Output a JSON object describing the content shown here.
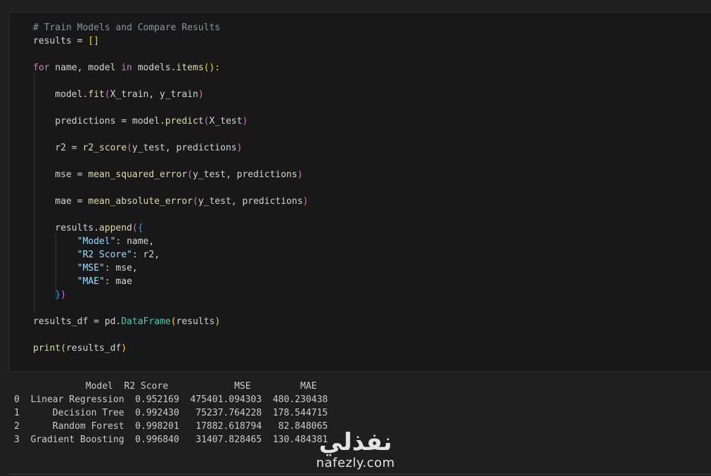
{
  "cell": {
    "code_lines": [
      [
        {
          "t": "# Train Models and Compare Results",
          "c": "comment"
        }
      ],
      [
        {
          "t": "results",
          "c": "plain"
        },
        {
          "t": " = ",
          "c": "plain"
        },
        {
          "t": "[]",
          "c": "b1"
        }
      ],
      [],
      [
        {
          "t": "for",
          "c": "kw"
        },
        {
          "t": " name, model ",
          "c": "plain"
        },
        {
          "t": "in",
          "c": "kw"
        },
        {
          "t": " models.",
          "c": "plain"
        },
        {
          "t": "items",
          "c": "fn"
        },
        {
          "t": "():",
          "c": "b1"
        }
      ],
      [],
      [
        {
          "t": "    model.",
          "c": "plain"
        },
        {
          "t": "fit",
          "c": "fn"
        },
        {
          "t": "(",
          "c": "b2"
        },
        {
          "t": "X_train, y_train",
          "c": "plain"
        },
        {
          "t": ")",
          "c": "b2"
        }
      ],
      [],
      [
        {
          "t": "    predictions = model.",
          "c": "plain"
        },
        {
          "t": "predict",
          "c": "fn"
        },
        {
          "t": "(",
          "c": "b2"
        },
        {
          "t": "X_test",
          "c": "plain"
        },
        {
          "t": ")",
          "c": "b2"
        }
      ],
      [],
      [
        {
          "t": "    r2 = ",
          "c": "plain"
        },
        {
          "t": "r2_score",
          "c": "fn"
        },
        {
          "t": "(",
          "c": "b2"
        },
        {
          "t": "y_test, predictions",
          "c": "plain"
        },
        {
          "t": ")",
          "c": "b2"
        }
      ],
      [],
      [
        {
          "t": "    mse = ",
          "c": "plain"
        },
        {
          "t": "mean_squared_error",
          "c": "fn"
        },
        {
          "t": "(",
          "c": "b2"
        },
        {
          "t": "y_test, predictions",
          "c": "plain"
        },
        {
          "t": ")",
          "c": "b2"
        }
      ],
      [],
      [
        {
          "t": "    mae = ",
          "c": "plain"
        },
        {
          "t": "mean_absolute_error",
          "c": "fn"
        },
        {
          "t": "(",
          "c": "b2"
        },
        {
          "t": "y_test, predictions",
          "c": "plain"
        },
        {
          "t": ")",
          "c": "b2"
        }
      ],
      [],
      [
        {
          "t": "    results.",
          "c": "plain"
        },
        {
          "t": "append",
          "c": "fn"
        },
        {
          "t": "(",
          "c": "b2"
        },
        {
          "t": "{",
          "c": "b3"
        }
      ],
      [
        {
          "t": "        ",
          "c": "plain"
        },
        {
          "t": "\"Model\"",
          "c": "var"
        },
        {
          "t": ": name,",
          "c": "plain"
        }
      ],
      [
        {
          "t": "        ",
          "c": "plain"
        },
        {
          "t": "\"R2 Score\"",
          "c": "var"
        },
        {
          "t": ": r2,",
          "c": "plain"
        }
      ],
      [
        {
          "t": "        ",
          "c": "plain"
        },
        {
          "t": "\"MSE\"",
          "c": "var"
        },
        {
          "t": ": mse,",
          "c": "plain"
        }
      ],
      [
        {
          "t": "        ",
          "c": "plain"
        },
        {
          "t": "\"MAE\"",
          "c": "var"
        },
        {
          "t": ": mae",
          "c": "plain"
        }
      ],
      [
        {
          "t": "    ",
          "c": "plain"
        },
        {
          "t": "}",
          "c": "b3"
        },
        {
          "t": ")",
          "c": "b2"
        }
      ],
      [],
      [
        {
          "t": "results_df = pd.",
          "c": "plain"
        },
        {
          "t": "DataFrame",
          "c": "fnblue"
        },
        {
          "t": "(",
          "c": "b1"
        },
        {
          "t": "results",
          "c": "plain"
        },
        {
          "t": ")",
          "c": "b1"
        }
      ],
      [],
      [
        {
          "t": "print",
          "c": "fn"
        },
        {
          "t": "(",
          "c": "b1"
        },
        {
          "t": "results_df",
          "c": "plain"
        },
        {
          "t": ")",
          "c": "b1"
        }
      ]
    ]
  },
  "output": {
    "header": "             Model  R2 Score            MSE         MAE",
    "rows": [
      "0  Linear Regression  0.952169  475401.094303  480.230438",
      "1      Decision Tree  0.992430   75237.764228  178.544715",
      "2      Random Forest  0.998201   17882.618794   82.848065",
      "3  Gradient Boosting  0.996840   31407.828465  130.484381"
    ]
  },
  "watermark": {
    "arabic": "نفذلي",
    "latin": "nafezly.com"
  }
}
